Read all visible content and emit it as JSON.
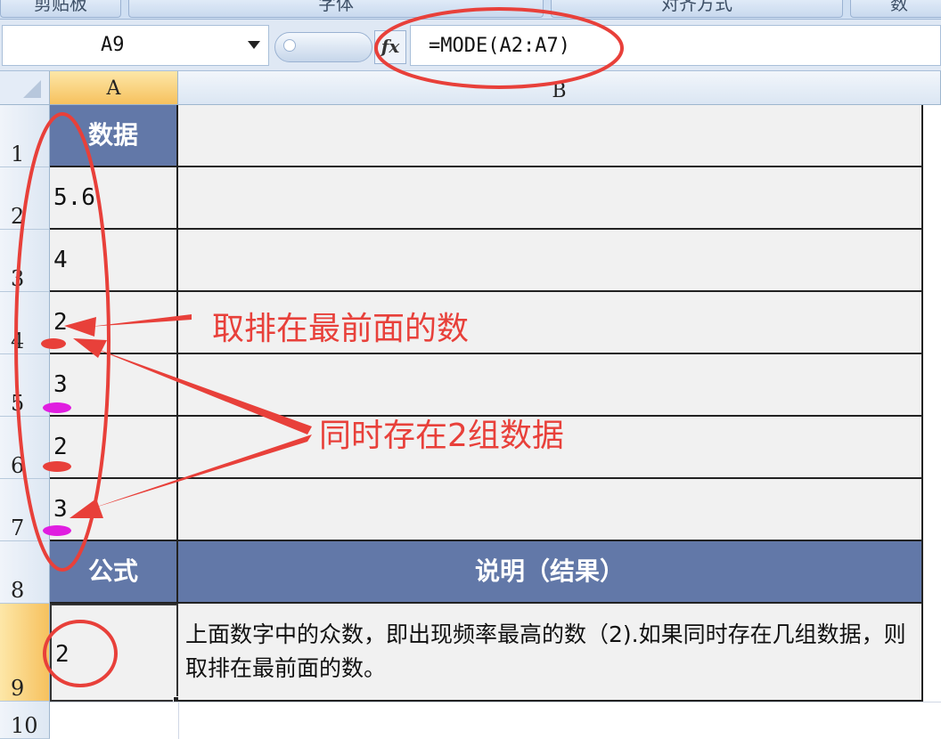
{
  "ribbon": {
    "groups": [
      "剪贴板",
      "字体",
      "对齐方式",
      "数"
    ]
  },
  "formula_bar": {
    "name_box": "A9",
    "fx_label": "fx",
    "formula": "=MODE(A2:A7)"
  },
  "columns": [
    "A",
    "B"
  ],
  "rows": [
    "1",
    "2",
    "3",
    "4",
    "5",
    "6",
    "7",
    "8",
    "9",
    "10"
  ],
  "table": {
    "header": "数据",
    "values": [
      "5.6",
      "4",
      "2",
      "3",
      "2",
      "3"
    ],
    "formula_header": "公式",
    "desc_header": "说明（结果）",
    "result": "2",
    "description": "上面数字中的众数，即出现频率最高的数（2).如果同时存在几组数据，则取排在最前面的数。"
  },
  "annotations": {
    "first_note": "取排在最前面的数",
    "second_note": "同时存在2组数据",
    "colors": {
      "red": "#e8403a",
      "magenta": "#e01ee0"
    }
  },
  "colors": {
    "header_fill": "#6278a8",
    "cell_fill": "#f1f1f1",
    "active_header": "#f6c15e"
  }
}
